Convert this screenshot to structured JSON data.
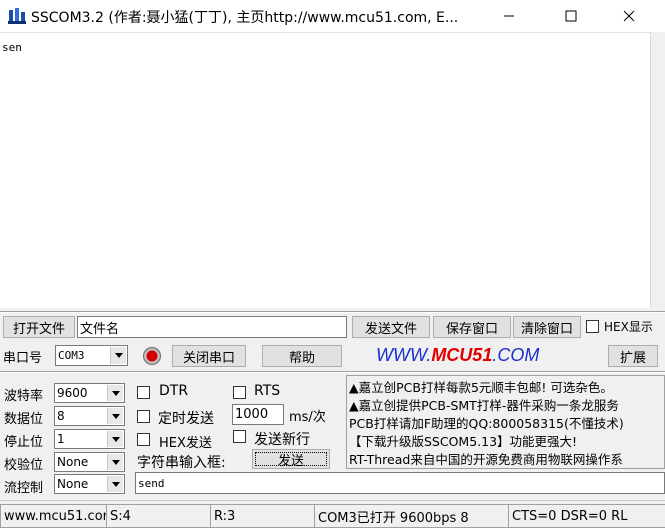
{
  "window": {
    "title": "SSCOM3.2 (作者:聂小猛(丁丁), 主页http://www.mcu51.com,  E...",
    "minimize_icon": "minimize-icon",
    "maximize_icon": "maximize-icon",
    "close_icon": "close-icon"
  },
  "receive": {
    "text": "sen"
  },
  "file_row": {
    "open_file": "打开文件",
    "filename": "文件名",
    "send_file": "发送文件",
    "save_window": "保存窗口",
    "clear_window": "清除窗口",
    "hex_display": "HEX显示"
  },
  "port_row": {
    "port_label": "串口号",
    "port_value": "COM3",
    "close_port": "关闭串口",
    "help": "帮助",
    "brand_prefix": "WWW.",
    "brand_main": "MCU51",
    "brand_suffix": ".COM",
    "expand": "扩展",
    "indicator_color": "#d40000"
  },
  "settings": {
    "baud_label": "波特率",
    "baud_value": "9600",
    "databits_label": "数据位",
    "databits_value": "8",
    "stopbits_label": "停止位",
    "stopbits_value": "1",
    "parity_label": "校验位",
    "parity_value": "None",
    "flow_label": "流控制",
    "flow_value": "None"
  },
  "options": {
    "dtr": "DTR",
    "rts": "RTS",
    "timed_send": "定时发送",
    "interval_value": "1000",
    "interval_unit": "ms/次",
    "hex_send": "HEX发送",
    "send_newline": "发送新行",
    "input_label": "字符串输入框:",
    "send_button": "发送",
    "send_text": "send"
  },
  "ads": [
    "▲嘉立创PCB打样每款5元顺丰包邮! 可选杂色。",
    "▲嘉立创提供PCB-SMT打样-器件采购一条龙服务",
    "PCB打样请加F助理的QQ:800058315(不懂技术)",
    "【下载升级版SSCOM5.13】功能更强大!",
    "RT-Thread来自中国的开源免费商用物联网操作系"
  ],
  "status": {
    "site": "www.mcu51.cor",
    "sent": "S:4",
    "received": "R:3",
    "port_state": "COM3已打开  9600bps  8",
    "lines": "CTS=0 DSR=0 RL"
  }
}
